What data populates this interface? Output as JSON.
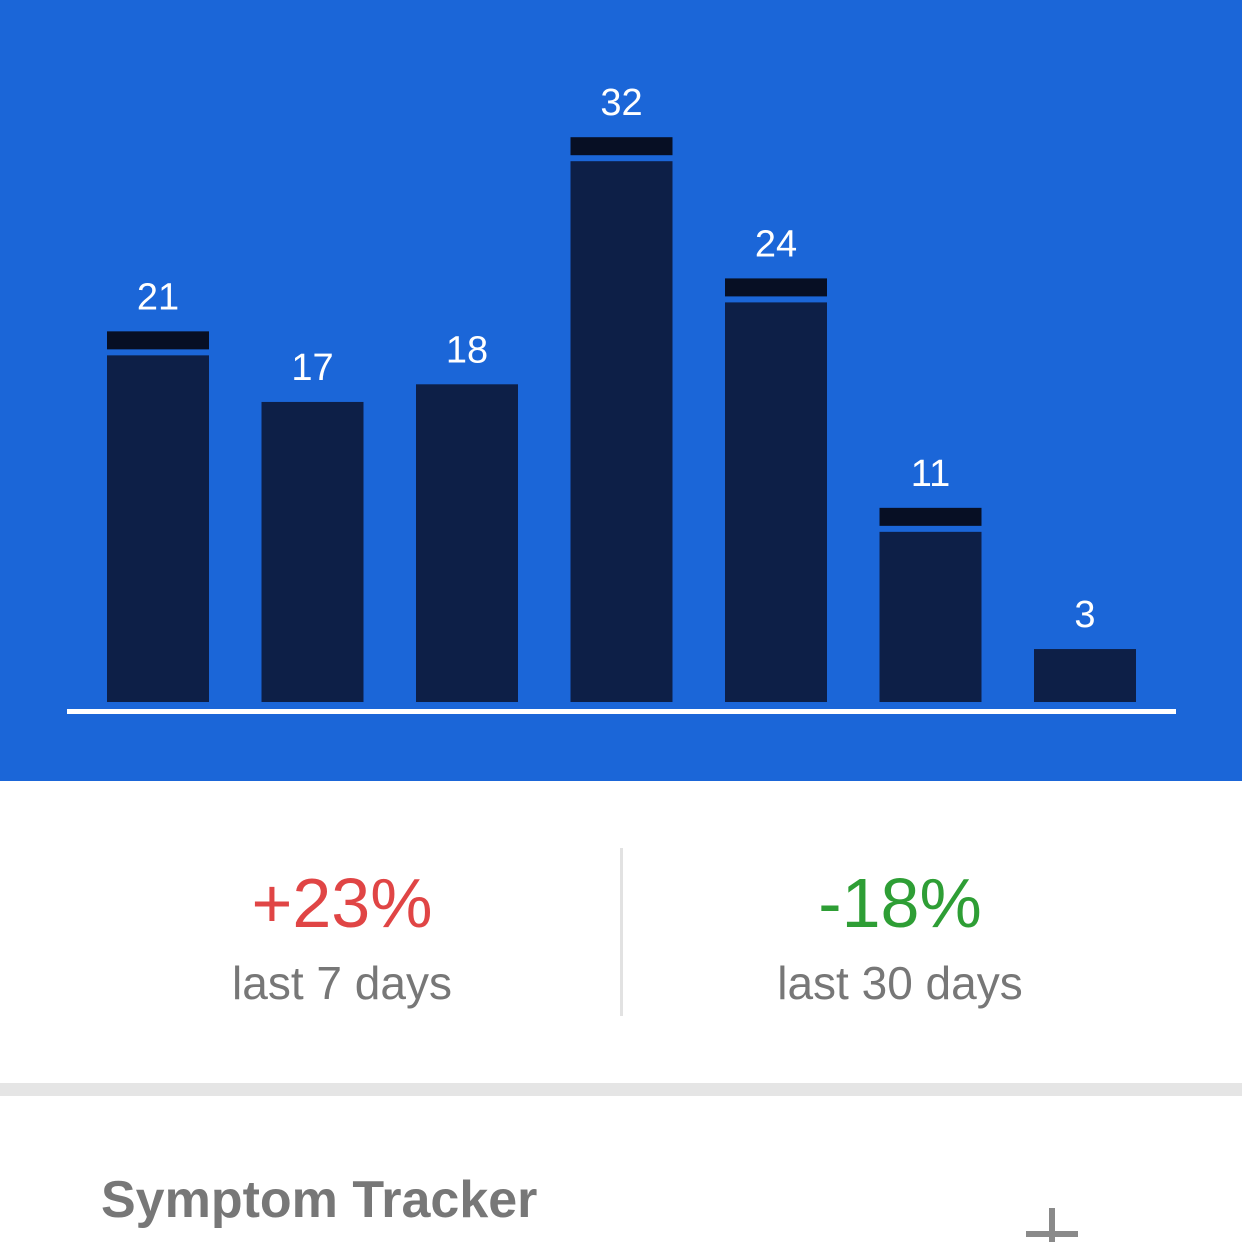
{
  "colors": {
    "chart_background": "#1b66d8",
    "bar_fill": "#0d1f47",
    "bar_cap": "#070f24",
    "baseline": "#ffffff",
    "increase": "#e04545",
    "decrease": "#2e9e35"
  },
  "chart_data": {
    "type": "bar",
    "values": [
      21,
      17,
      18,
      32,
      24,
      11,
      3
    ],
    "labels": [
      "21",
      "17",
      "18",
      "32",
      "24",
      "11",
      "3"
    ],
    "has_cap": [
      true,
      false,
      false,
      true,
      true,
      true,
      false
    ]
  },
  "stats": {
    "week": {
      "value": "+23%",
      "caption": "last 7 days"
    },
    "month": {
      "value": "-18%",
      "caption": "last 30 days"
    }
  },
  "tracker": {
    "title": "Symptom Tracker",
    "add_icon": "plus-icon"
  }
}
